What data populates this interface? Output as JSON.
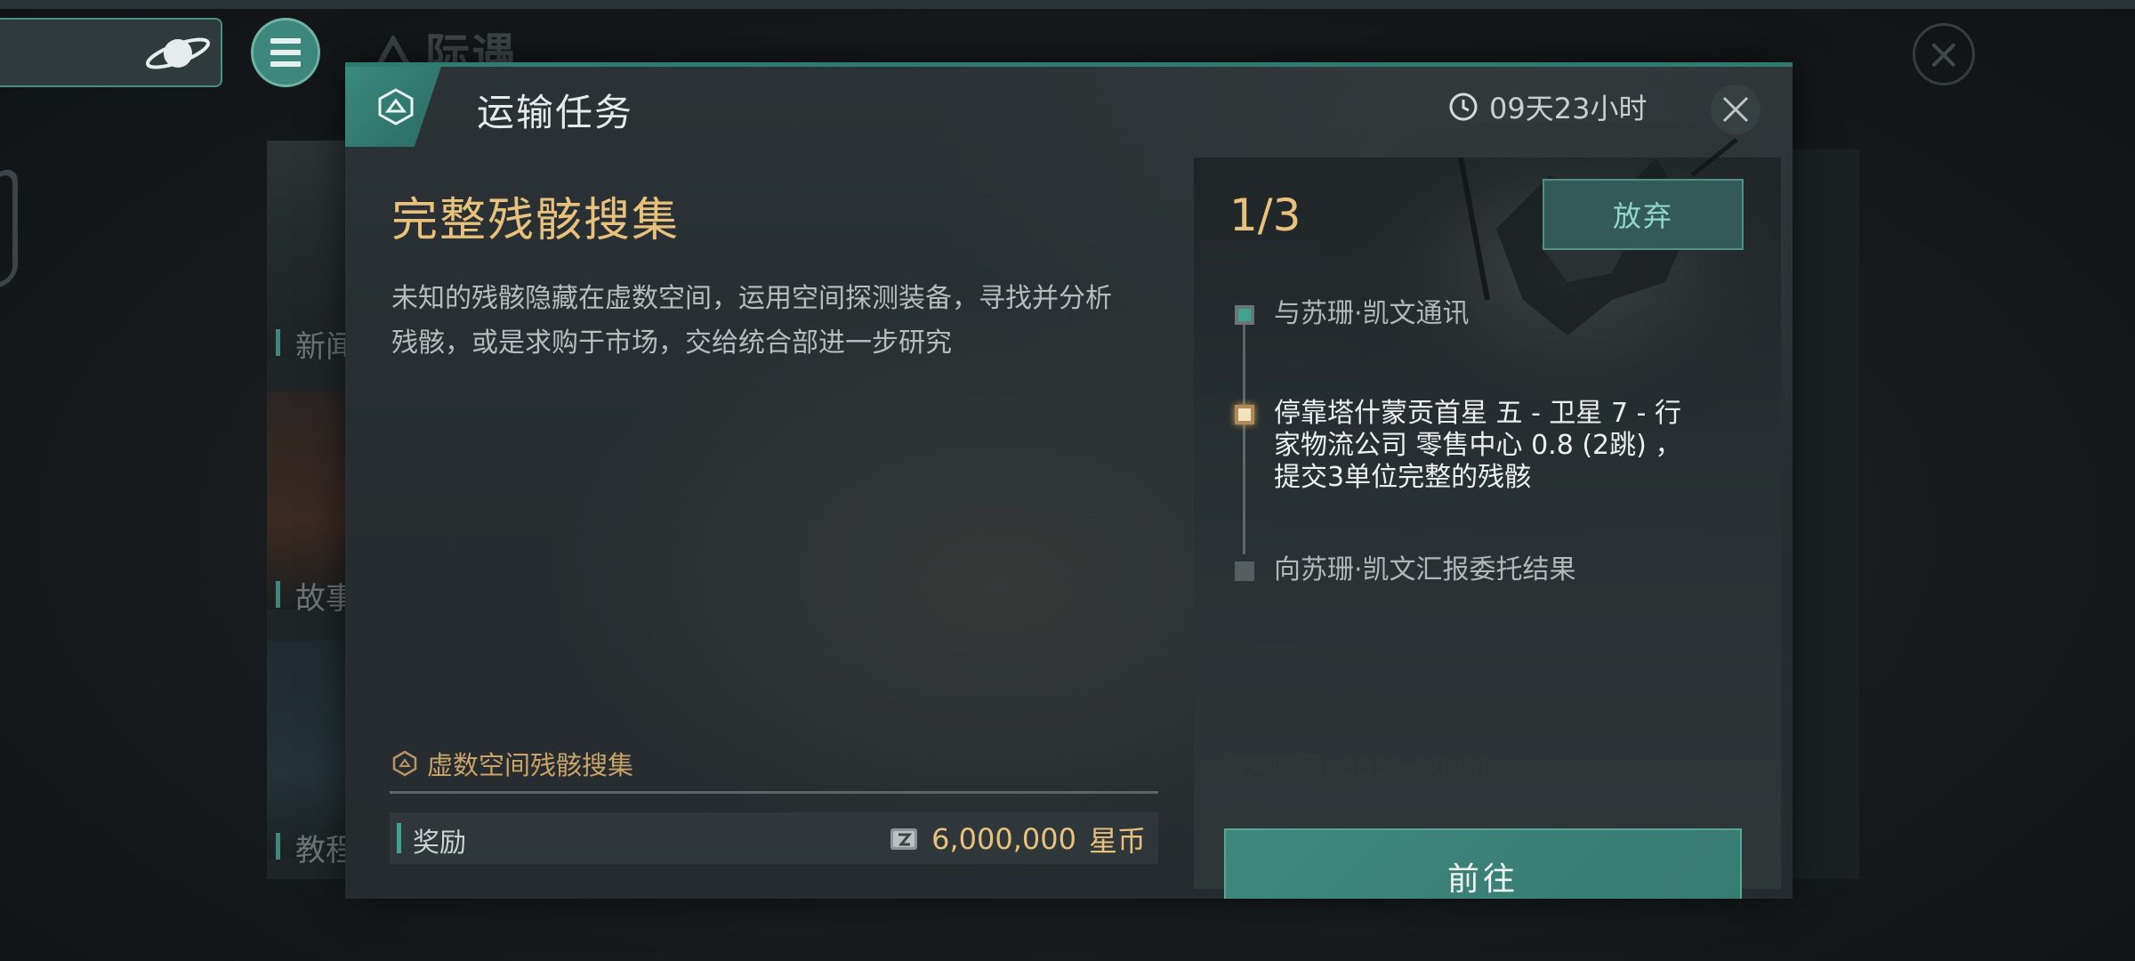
{
  "background": {
    "title": "际遇",
    "cards": [
      "新闻",
      "故事",
      "教程"
    ]
  },
  "dialog": {
    "title": "运输任务",
    "timer": "09天23小时",
    "mission_name": "完整残骸搜集",
    "description": "未知的残骸隐藏在虚数空间，运用空间探测装备，寻找并分析残骸，或是求购于市场，交给统合部进一步研究",
    "category": "虚数空间残骸搜集",
    "end_time": "结束时间: 2021-10-04",
    "reward": {
      "label": "奖励",
      "amount": "6,000,000",
      "unit": "星币"
    },
    "progress": "1/3",
    "abandon_label": "放弃",
    "steps": [
      {
        "text": "与苏珊·凯文通讯",
        "state": "done"
      },
      {
        "text": "停靠塔什蒙贡首星 五 - 卫星 7 - 行家物流公司 零售中心 0.8 (2跳) ，提交3单位完整的残骸",
        "state": "current"
      },
      {
        "text": "向苏珊·凯文汇报委托结果",
        "state": "todo"
      }
    ],
    "go_label": "前往"
  },
  "icons": {
    "planet": "planet-icon",
    "menu": "menu-icon",
    "badge": "mission-badge-icon",
    "clock": "clock-icon",
    "close": "close-icon",
    "category": "hexagon-icon",
    "coin": "star-coin-icon"
  },
  "colors": {
    "accent": "#3f877c",
    "gold": "#e8c27d",
    "panel": "#2b3235"
  }
}
